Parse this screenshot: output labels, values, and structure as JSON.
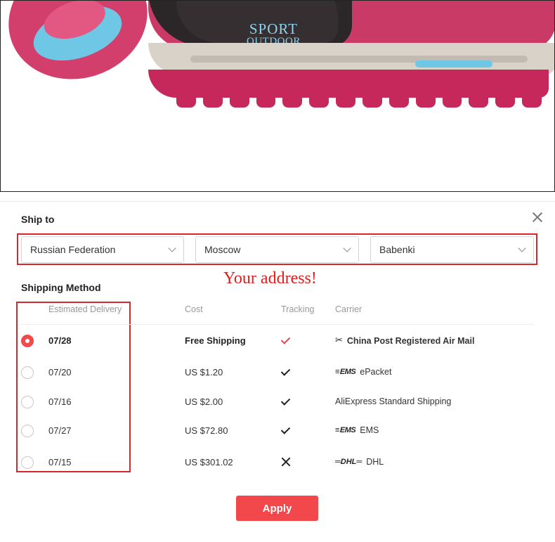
{
  "banner": {
    "brand_line1": "SPORT",
    "brand_line2": "OUTDOOR"
  },
  "ship_to": {
    "title": "Ship to",
    "country": "Russian Federation",
    "city": "Moscow",
    "district": "Babenki",
    "note": "Your address!"
  },
  "shipping": {
    "title": "Shipping Method",
    "headers": {
      "delivery": "Estimated Delivery",
      "cost": "Cost",
      "tracking": "Tracking",
      "carrier": "Carrier"
    },
    "rows": [
      {
        "date": "07/28",
        "cost": "Free Shipping",
        "tracking": "yes",
        "carrier_logo": "China Post",
        "carrier_name": "China Post Registered Air Mail",
        "selected": true
      },
      {
        "date": "07/20",
        "cost": "US $1.20",
        "tracking": "yes",
        "carrier_logo": "EMS",
        "carrier_name": "ePacket",
        "selected": false
      },
      {
        "date": "07/16",
        "cost": "US $2.00",
        "tracking": "yes",
        "carrier_logo": "",
        "carrier_name": "AliExpress Standard Shipping",
        "selected": false
      },
      {
        "date": "07/27",
        "cost": "US $72.80",
        "tracking": "yes",
        "carrier_logo": "EMS",
        "carrier_name": "EMS",
        "selected": false
      },
      {
        "date": "07/15",
        "cost": "US $301.02",
        "tracking": "no",
        "carrier_logo": "DHL",
        "carrier_name": "DHL",
        "selected": false
      }
    ]
  },
  "apply_label": "Apply",
  "colors": {
    "accent": "#f2484b",
    "highlight_border": "#d8262e",
    "note_text": "#e11d1d"
  }
}
